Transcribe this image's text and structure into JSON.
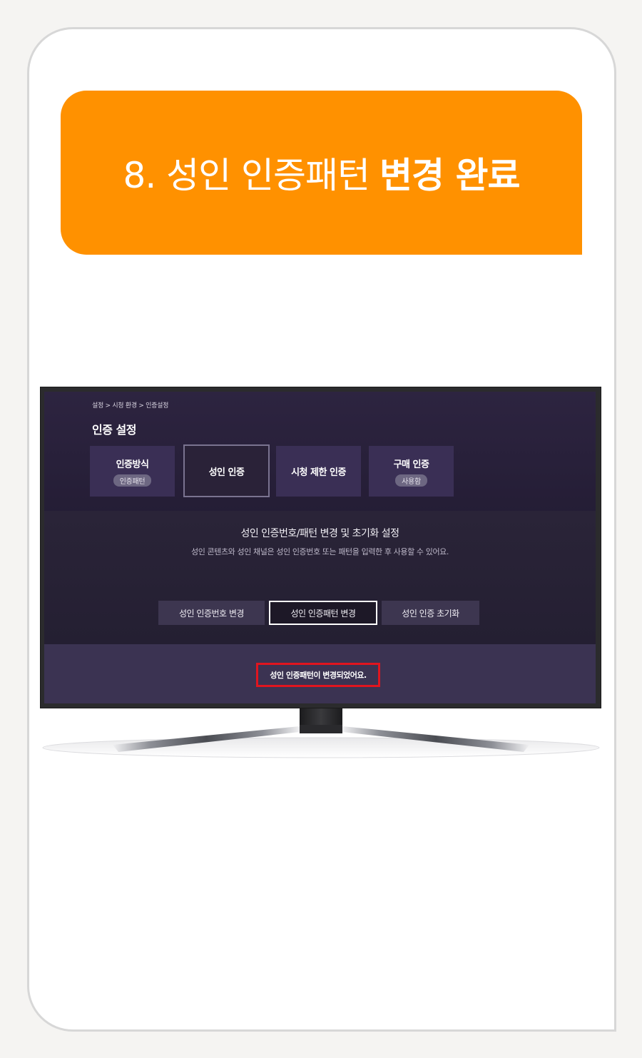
{
  "banner": {
    "step_text": "8. 성인 인증패턴",
    "bold_text": "변경 완료",
    "color": "#ff9100"
  },
  "tv": {
    "breadcrumb": "설정 > 시청 환경 > 인증설정",
    "title": "인증 설정",
    "tabs": [
      {
        "label": "인증방식",
        "pill": "인증패턴",
        "selected": false
      },
      {
        "label": "성인 인증",
        "pill": null,
        "selected": true
      },
      {
        "label": "시청 제한 인증",
        "pill": null,
        "selected": false
      },
      {
        "label": "구매 인증",
        "pill": "사용함",
        "selected": false
      }
    ],
    "panel": {
      "heading": "성인 인증번호/패턴 변경 및 초기화 설정",
      "description": "성인 콘텐츠와 성인 채널은 성인 인증번호 또는 패턴을 입력한 후 사용할 수 있어요.",
      "buttons": [
        {
          "label": "성인 인증번호 변경",
          "selected": false
        },
        {
          "label": "성인 인증패턴 변경",
          "selected": true
        },
        {
          "label": "성인 인증 초기화",
          "selected": false
        }
      ]
    },
    "toast": {
      "message": "성인 인증패턴이 변경되었어요.",
      "highlight_color": "#e0151f"
    }
  }
}
